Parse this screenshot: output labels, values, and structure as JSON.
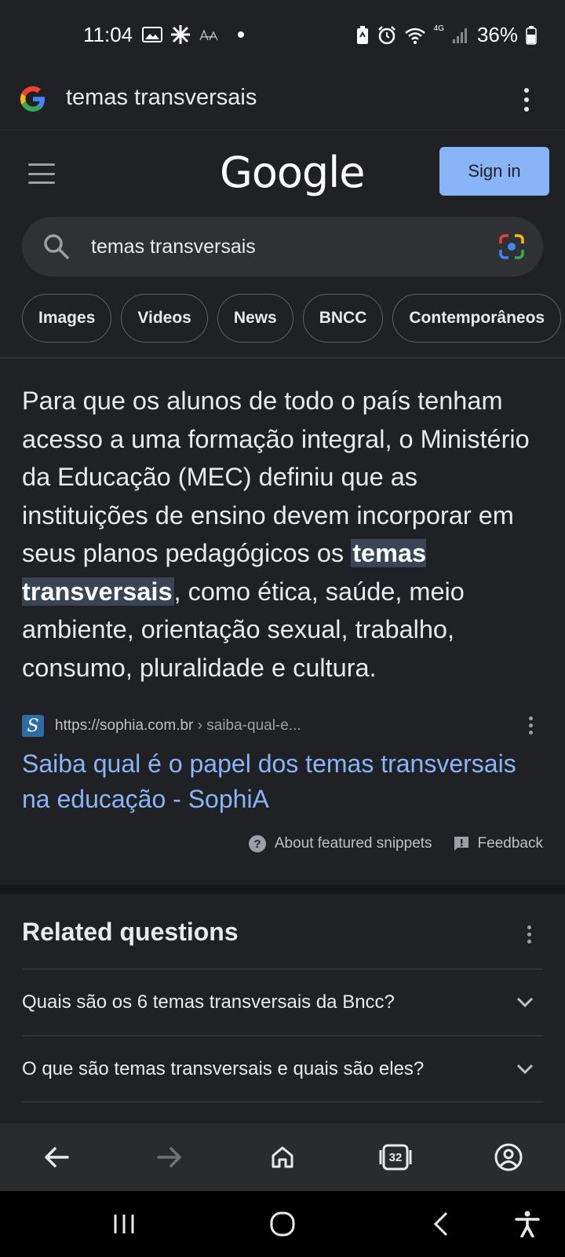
{
  "status_bar": {
    "time": "11:04",
    "battery": "36%",
    "network": "4G"
  },
  "url_bar": {
    "query": "temas transversais"
  },
  "header": {
    "logo": "Google",
    "sign_in": "Sign in"
  },
  "search": {
    "value": "temas transversais"
  },
  "chips": [
    "Images",
    "Videos",
    "News",
    "BNCC",
    "Contemporâneos"
  ],
  "snippet": {
    "text_before": "Para que os alunos de todo o país tenham acesso a uma formação integral, o Ministério da Educação (MEC) definiu que as instituições de ensino devem incorporar em seus planos pedagógicos os ",
    "highlight": "temas transversais",
    "text_after": ", como ética, saúde, meio ambiente, orientação sexual, trabalho, consumo, pluralidade e cultura.",
    "source_domain": "https://sophia.com.br",
    "source_path": " › saiba-qual-e...",
    "favicon_letter": "S",
    "title": "Saiba qual é o papel dos temas transversais na educação - SophiA",
    "about_label": "About featured snippets",
    "feedback_label": "Feedback"
  },
  "related": {
    "title": "Related questions",
    "questions": [
      "Quais são os 6 temas transversais da Bncc?",
      "O que são temas transversais e quais são eles?"
    ]
  },
  "bottom_nav": {
    "tab_count": "32"
  },
  "colors": {
    "background": "#202124",
    "link": "#8ab4f8",
    "sign_in_bg": "#8ab4f8",
    "highlight_bg": "#394457"
  }
}
